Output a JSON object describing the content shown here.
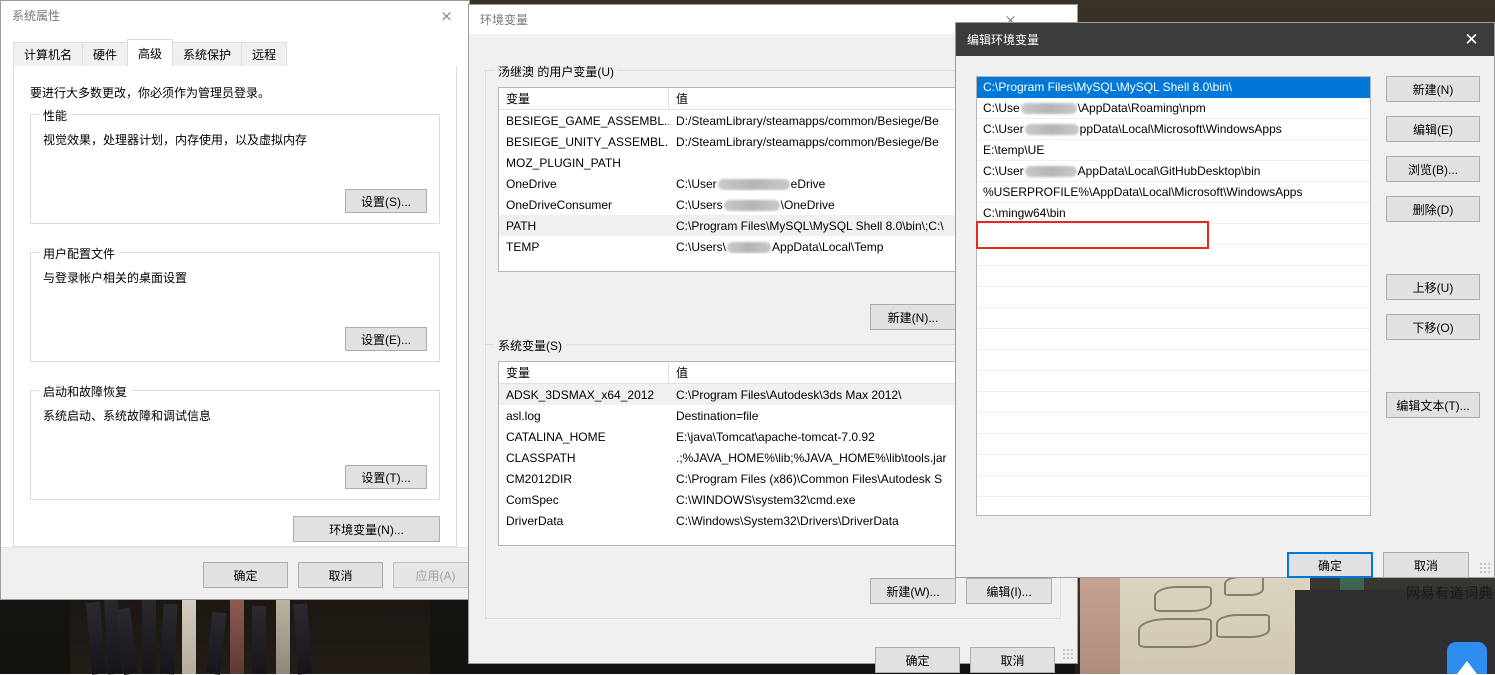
{
  "desktop": {
    "youdao_label": "网易有道词典",
    "youdao_icon": "youdao-dictionary-icon"
  },
  "system_properties": {
    "title": "系统属性",
    "close_icon": "×",
    "tabs": [
      {
        "label": "计算机名",
        "active": false
      },
      {
        "label": "硬件",
        "active": false
      },
      {
        "label": "高级",
        "active": true
      },
      {
        "label": "系统保护",
        "active": false
      },
      {
        "label": "远程",
        "active": false
      }
    ],
    "admin_note": "要进行大多数更改，你必须作为管理员登录。",
    "groups": [
      {
        "label": "性能",
        "description": "视觉效果，处理器计划，内存使用，以及虚拟内存",
        "button": "设置(S)..."
      },
      {
        "label": "用户配置文件",
        "description": "与登录帐户相关的桌面设置",
        "button": "设置(E)..."
      },
      {
        "label": "启动和故障恢复",
        "description": "系统启动、系统故障和调试信息",
        "button": "设置(T)..."
      }
    ],
    "env_button": "环境变量(N)...",
    "footer": {
      "ok": "确定",
      "cancel": "取消",
      "apply": "应用(A)"
    }
  },
  "env_vars": {
    "title": "环境变量",
    "close_icon": "×",
    "user_group_label": "汤继澳 的用户变量(U)",
    "system_group_label": "系统变量(S)",
    "columns": [
      "变量",
      "值"
    ],
    "user_rows": [
      {
        "name": "BESIEGE_GAME_ASSEMBL...",
        "value": "D:/SteamLibrary/steamapps/common/Besiege/Be",
        "selected": false
      },
      {
        "name": "BESIEGE_UNITY_ASSEMBL...",
        "value": "D:/SteamLibrary/steamapps/common/Besiege/Be",
        "selected": false
      },
      {
        "name": "MOZ_PLUGIN_PATH",
        "value": "",
        "selected": false
      },
      {
        "name": "OneDrive",
        "value": "C:\\User",
        "value_suffix": "eDrive",
        "redacted": true,
        "selected": false
      },
      {
        "name": "OneDriveConsumer",
        "value": "C:\\Users",
        "value_suffix": "\\OneDrive",
        "redacted": true,
        "selected": false
      },
      {
        "name": "PATH",
        "value": "C:\\Program Files\\MySQL\\MySQL Shell 8.0\\bin\\;C:\\",
        "selected": true
      },
      {
        "name": "TEMP",
        "value": "C:\\Users\\",
        "value_suffix": "AppData\\Local\\Temp",
        "redacted": true,
        "selected": false
      }
    ],
    "user_buttons": {
      "new": "新建(N)...",
      "edit": "编辑(E)..."
    },
    "system_rows": [
      {
        "name": "ADSK_3DSMAX_x64_2012",
        "value": "C:\\Program Files\\Autodesk\\3ds Max 2012\\",
        "selected": true
      },
      {
        "name": "asl.log",
        "value": "Destination=file",
        "selected": false
      },
      {
        "name": "CATALINA_HOME",
        "value": "E:\\java\\Tomcat\\apache-tomcat-7.0.92",
        "selected": false
      },
      {
        "name": "CLASSPATH",
        "value": ".;%JAVA_HOME%\\lib;%JAVA_HOME%\\lib\\tools.jar",
        "selected": false
      },
      {
        "name": "CM2012DIR",
        "value": "C:\\Program Files (x86)\\Common Files\\Autodesk S",
        "selected": false
      },
      {
        "name": "ComSpec",
        "value": "C:\\WINDOWS\\system32\\cmd.exe",
        "selected": false
      },
      {
        "name": "DriverData",
        "value": "C:\\Windows\\System32\\Drivers\\DriverData",
        "selected": false
      }
    ],
    "system_buttons": {
      "new": "新建(W)...",
      "edit": "编辑(I)..."
    },
    "footer": {
      "ok": "确定",
      "cancel": "取消"
    }
  },
  "edit_env": {
    "title": "编辑环境变量",
    "close_icon": "✕",
    "paths": [
      {
        "text": "C:\\Program Files\\MySQL\\MySQL Shell 8.0\\bin\\",
        "selected": true,
        "redacted": false
      },
      {
        "prefix": "C:\\Use",
        "suffix": "\\AppData\\Roaming\\npm",
        "selected": false,
        "redacted": true
      },
      {
        "prefix": "C:\\User",
        "suffix": "ppData\\Local\\Microsoft\\WindowsApps",
        "selected": false,
        "redacted": true
      },
      {
        "text": "E:\\temp\\UE",
        "selected": false,
        "redacted": false
      },
      {
        "prefix": "C:\\User",
        "suffix": "AppData\\Local\\GitHubDesktop\\bin",
        "selected": false,
        "redacted": true
      },
      {
        "text": "%USERPROFILE%\\AppData\\Local\\Microsoft\\WindowsApps",
        "selected": false,
        "redacted": false
      },
      {
        "text": "C:\\mingw64\\bin",
        "selected": false,
        "redacted": false,
        "highlighted": true
      }
    ],
    "side_buttons": [
      {
        "label": "新建(N)",
        "name": "new-button"
      },
      {
        "label": "编辑(E)",
        "name": "edit-button"
      },
      {
        "label": "浏览(B)...",
        "name": "browse-button"
      },
      {
        "label": "删除(D)",
        "name": "delete-button"
      },
      {
        "label": "上移(U)",
        "name": "move-up-button"
      },
      {
        "label": "下移(O)",
        "name": "move-down-button"
      },
      {
        "label": "编辑文本(T)...",
        "name": "edit-text-button"
      }
    ],
    "footer": {
      "ok": "确定",
      "cancel": "取消"
    },
    "highlight_color": "#e8271f"
  }
}
